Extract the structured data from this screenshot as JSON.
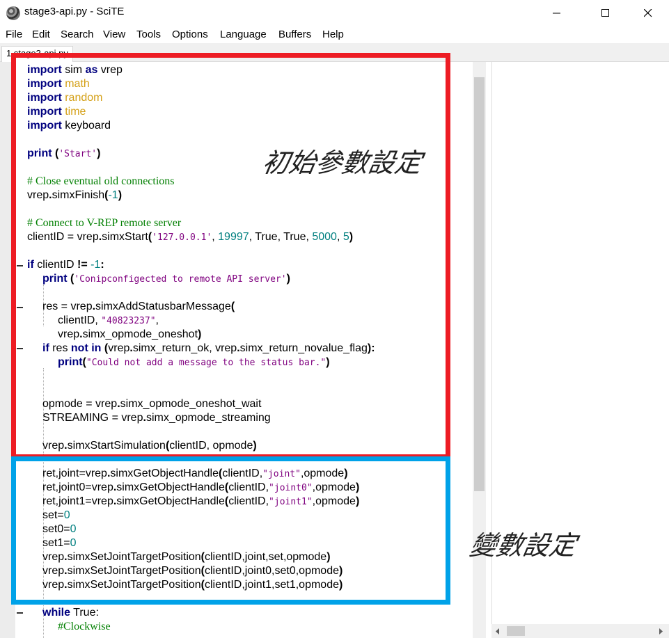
{
  "window": {
    "title": "stage3-api.py - SciTE"
  },
  "menu": [
    "File",
    "Edit",
    "Search",
    "View",
    "Tools",
    "Options",
    "Language",
    "Buffers",
    "Help"
  ],
  "tab": {
    "label": "1 stage3-api.py"
  },
  "code": {
    "l1": [
      "import",
      " sim ",
      "as",
      " vrep"
    ],
    "l2": [
      "import",
      " math"
    ],
    "l3": [
      "import",
      " random"
    ],
    "l4": [
      "import",
      " time"
    ],
    "l5": [
      "import",
      " keyboard"
    ],
    "l7": [
      "print",
      " (",
      "'Start'",
      ")"
    ],
    "l9": "# Close eventual old connections",
    "l10": [
      "vrep",
      ".",
      "simxFinish",
      "(",
      "-1",
      ")"
    ],
    "l12": "# Connect to V-REP remote server",
    "l13": [
      "clientID = vrep",
      ".",
      "simxStart",
      "(",
      "'127.0.0.1'",
      ", ",
      "19997",
      ", True, True, ",
      "5000",
      ", ",
      "5",
      ")"
    ],
    "l15": [
      "if",
      " clientID ",
      "!=",
      " ",
      "-1",
      ":"
    ],
    "l16": [
      "print",
      " (",
      "'Conipconfigected to remote API server'",
      ")"
    ],
    "l18": [
      "res = vrep",
      ".",
      "simxAddStatusbarMessage",
      "("
    ],
    "l19": [
      "clientID",
      ", ",
      "\"40823237\"",
      ","
    ],
    "l20": [
      "vrep",
      ".",
      "simx_opmode_oneshot",
      ")"
    ],
    "l21": [
      "if",
      " res ",
      "not",
      " ",
      "in",
      " ",
      "(",
      "vrep",
      ".",
      "simx_return_ok",
      ", vrep",
      ".",
      "simx_return_novalue_flag",
      "):"
    ],
    "l22": [
      "print",
      "(",
      "\"Could not add a message to the status bar.\"",
      ")"
    ],
    "l25": [
      "opmode = vrep",
      ".",
      "simx_opmode_oneshot_wait"
    ],
    "l26": [
      "STREAMING = vrep",
      ".",
      "simx_opmode_streaming"
    ],
    "l28": [
      "vrep",
      ".",
      "simxStartSimulation",
      "(",
      "clientID, opmode",
      ")"
    ],
    "l30": [
      "ret,joint=vrep",
      ".",
      "simxGetObjectHandle",
      "(",
      "clientID,",
      "\"joint\"",
      ",opmode",
      ")"
    ],
    "l31": [
      "ret,joint0=vrep",
      ".",
      "simxGetObjectHandle",
      "(",
      "clientID,",
      "\"joint0\"",
      ",opmode",
      ")"
    ],
    "l32": [
      "ret,joint1=vrep",
      ".",
      "simxGetObjectHandle",
      "(",
      "clientID,",
      "\"joint1\"",
      ",opmode",
      ")"
    ],
    "l33": [
      "set=",
      "0"
    ],
    "l34": [
      "set0=",
      "0"
    ],
    "l35": [
      "set1=",
      "0"
    ],
    "l36": [
      "vrep",
      ".",
      "simxSetJointTargetPosition",
      "(",
      "clientID,joint,set,opmode",
      ")"
    ],
    "l37": [
      "vrep",
      ".",
      "simxSetJointTargetPosition",
      "(",
      "clientID,joint0,set0,opmode",
      ")"
    ],
    "l38": [
      "vrep",
      ".",
      "simxSetJointTargetPosition",
      "(",
      "clientID,joint1,set1,opmode",
      ")"
    ],
    "l40": [
      "while",
      " True:"
    ],
    "l41": "#Clockwise"
  },
  "annotations": {
    "init": "初始參數設定",
    "var": "變數設定"
  },
  "colors": {
    "red_box": "#ed1c24",
    "blue_box": "#00a2e8",
    "keyword": "#00007f",
    "string": "#7f007f",
    "number": "#007f7f",
    "comment": "#007f00",
    "module": "#d4a017"
  }
}
